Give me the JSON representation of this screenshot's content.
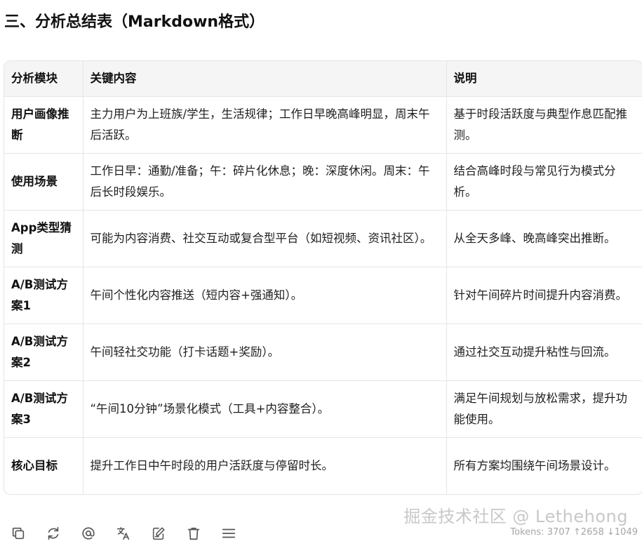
{
  "heading": "三、分析总结表（Markdown格式）",
  "table": {
    "headers": [
      "分析模块",
      "关键内容",
      "说明"
    ],
    "rows": [
      {
        "module": "用户画像推断",
        "content": "主力用户为上班族/学生，生活规律；工作日早晚高峰明显，周末午后活跃。",
        "note": "基于时段活跃度与典型作息匹配推测。"
      },
      {
        "module": "使用场景",
        "content": "工作日早：通勤/准备；午：碎片化休息；晚：深度休闲。周末：午后长时段娱乐。",
        "note": "结合高峰时段与常见行为模式分析。"
      },
      {
        "module": "App类型猜测",
        "content": "可能为内容消费、社交互动或复合型平台（如短视频、资讯社区）。",
        "note": "从全天多峰、晚高峰突出推断。"
      },
      {
        "module": "A/B测试方案1",
        "content": "午间个性化内容推送（短内容+强通知）。",
        "note": "针对午间碎片时间提升内容消费。"
      },
      {
        "module": "A/B测试方案2",
        "content": "午间轻社交功能（打卡话题+奖励）。",
        "note": "通过社交互动提升粘性与回流。"
      },
      {
        "module": "A/B测试方案3",
        "content": "“午间10分钟”场景化模式（工具+内容整合）。",
        "note": "满足午间规划与放松需求，提升功能使用。"
      },
      {
        "module": "核心目标",
        "content": "提升工作日中午时段的用户活跃度与停留时长。",
        "note": "所有方案均围绕午间场景设计。"
      }
    ]
  },
  "toolbar": {
    "buttons": [
      {
        "icon": "copy-icon",
        "name": "copy-button"
      },
      {
        "icon": "refresh-icon",
        "name": "regenerate-button"
      },
      {
        "icon": "at-icon",
        "name": "mention-button"
      },
      {
        "icon": "translate-icon",
        "name": "translate-button"
      },
      {
        "icon": "edit-icon",
        "name": "edit-button"
      },
      {
        "icon": "trash-icon",
        "name": "delete-button"
      },
      {
        "icon": "menu-icon",
        "name": "more-button"
      }
    ]
  },
  "watermark": "掘金技术社区 @ Lethehong",
  "tokens": "Tokens: 3707 ↑2658 ↓1049",
  "colors": {
    "header_bg": "#f5f5f5",
    "border": "#e5e5e5",
    "icon": "#555555"
  }
}
